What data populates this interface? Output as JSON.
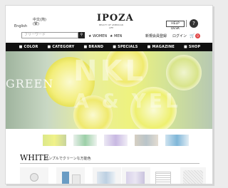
{
  "header": {
    "language": "English",
    "locale_line1": "中文(简)",
    "locale_line2": "(繁)",
    "logo": "IPOZA",
    "logo_sub": "BEAUTY OF AMERICAN LIFE",
    "help_button": "HELP DESK",
    "help_icon": "?",
    "search_placeholder": "フリーワード",
    "search_icon": "search-icon",
    "nav": [
      "WOMEN",
      "MEN"
    ],
    "member_register": "新規会員登録",
    "login": "ログイン",
    "cart_icon": "cart-icon",
    "cart_count": "0"
  },
  "categories": [
    "COLOR",
    "CATEGORY",
    "BRAND",
    "SPECIALS",
    "MAGAZINE",
    "SHOP"
  ],
  "hero": {
    "text_left": "GREEN",
    "text_big_1": "NKL",
    "text_big_2": "A & YEL"
  },
  "section": {
    "title": "WHITE",
    "subtitle": "シンプルでクリーンな万能色"
  },
  "colors": {
    "nav_bar": "#111111",
    "accent_red": "#e04444",
    "hero_yellow": "#eef27e"
  }
}
